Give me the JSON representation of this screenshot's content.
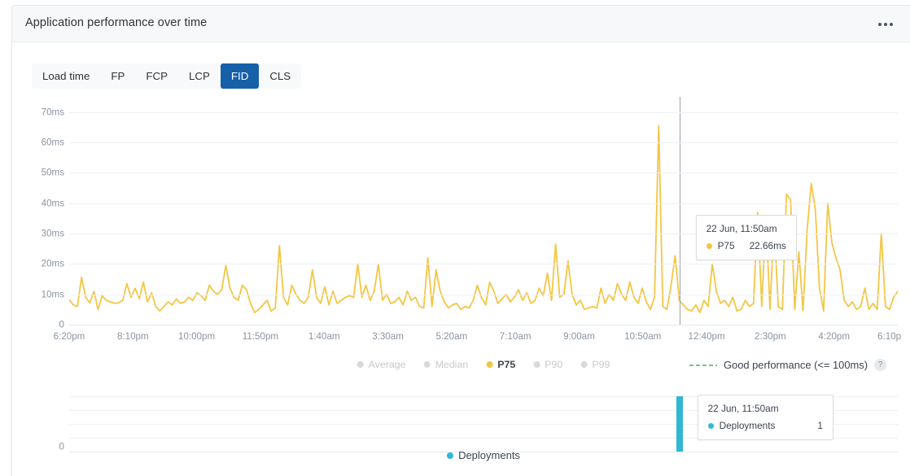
{
  "card": {
    "title": "Application performance over time",
    "menu_icon": "kebab-menu-icon"
  },
  "tabs": [
    {
      "label": "Load time",
      "active": false
    },
    {
      "label": "FP",
      "active": false
    },
    {
      "label": "FCP",
      "active": false
    },
    {
      "label": "LCP",
      "active": false
    },
    {
      "label": "FID",
      "active": true
    },
    {
      "label": "CLS",
      "active": false
    }
  ],
  "colors": {
    "accent_tab": "#1660a8",
    "p75_line": "#f3c644",
    "deployments": "#2fb8d6",
    "good_performance": "#7ec47e",
    "grid": "#eef0f2",
    "axis_text": "#8a94a0"
  },
  "legend": {
    "series": [
      {
        "label": "Average",
        "active": false,
        "color": "#d6d9dd"
      },
      {
        "label": "Median",
        "active": false,
        "color": "#d6d9dd"
      },
      {
        "label": "P75",
        "active": true,
        "color": "#f3c644"
      },
      {
        "label": "P90",
        "active": false,
        "color": "#d6d9dd"
      },
      {
        "label": "P99",
        "active": false,
        "color": "#d6d9dd"
      }
    ],
    "threshold_label": "Good performance (<= 100ms)",
    "help_icon": "?"
  },
  "tooltips": {
    "main": {
      "date": "22 Jun, 11:50am",
      "series_label": "P75",
      "value": "22.66ms",
      "dot_color": "#f3c644"
    },
    "deployments": {
      "date": "22 Jun, 11:50am",
      "series_label": "Deployments",
      "value": "1",
      "dot_color": "#2fb8d6"
    }
  },
  "deployments_legend": {
    "label": "Deployments",
    "color": "#2fb8d6"
  },
  "chart_data": {
    "type": "line",
    "title": "Application performance over time",
    "metric": "FID",
    "xlabel": "",
    "ylabel": "",
    "unit": "ms",
    "ylim": [
      0,
      75
    ],
    "yticks": [
      0,
      10,
      20,
      30,
      40,
      50,
      60,
      70
    ],
    "ytick_labels": [
      "0",
      "10ms",
      "20ms",
      "30ms",
      "40ms",
      "50ms",
      "60ms",
      "70ms"
    ],
    "xtick_labels": [
      "6:20pm",
      "8:10pm",
      "10:00pm",
      "11:50pm",
      "1:40am",
      "3:30am",
      "5:20am",
      "7:10am",
      "9:00am",
      "10:50am",
      "12:40pm",
      "2:30pm",
      "4:20pm",
      "6:10p"
    ],
    "grid": true,
    "legend_position": "bottom",
    "hover_index": 148,
    "series": [
      {
        "name": "P75",
        "color": "#f3c644",
        "visible": true,
        "values": [
          8.2,
          6.5,
          6.0,
          15.6,
          9.0,
          7.2,
          11.0,
          5.0,
          9.5,
          8.0,
          7.5,
          7.0,
          7.2,
          8.0,
          13.5,
          9.0,
          12.0,
          8.5,
          14.0,
          7.5,
          10.5,
          6.0,
          4.5,
          6.0,
          7.5,
          6.5,
          8.5,
          7.0,
          7.5,
          9.0,
          8.0,
          10.5,
          9.5,
          8.0,
          13.0,
          11.0,
          10.0,
          11.5,
          19.5,
          12.0,
          9.0,
          8.0,
          13.0,
          11.5,
          7.0,
          4.0,
          5.0,
          6.5,
          8.0,
          4.5,
          5.5,
          26.0,
          9.0,
          6.5,
          13.0,
          10.0,
          8.0,
          7.0,
          9.0,
          18.0,
          9.0,
          7.0,
          12.5,
          6.5,
          11.0,
          7.0,
          8.0,
          9.0,
          9.5,
          9.0,
          20.0,
          9.0,
          13.0,
          8.0,
          11.0,
          20.0,
          8.0,
          10.0,
          7.0,
          7.5,
          9.0,
          6.5,
          11.0,
          8.0,
          9.0,
          6.0,
          5.5,
          22.0,
          6.0,
          18.0,
          11.0,
          7.5,
          5.5,
          6.5,
          7.0,
          5.0,
          6.0,
          5.5,
          8.0,
          13.0,
          9.0,
          6.5,
          14.0,
          11.0,
          7.0,
          8.5,
          10.0,
          7.5,
          9.0,
          11.5,
          8.0,
          10.5,
          7.0,
          8.0,
          12.0,
          9.5,
          17.0,
          8.0,
          26.5,
          9.0,
          10.0,
          21.0,
          10.0,
          6.5,
          8.0,
          5.0,
          5.5,
          6.0,
          5.5,
          12.0,
          7.0,
          10.0,
          8.0,
          13.5,
          10.0,
          8.0,
          14.0,
          9.0,
          7.0,
          12.0,
          7.5,
          5.0,
          9.0,
          65.5,
          6.0,
          5.0,
          13.0,
          22.66,
          8.0,
          6.5,
          5.0,
          4.5,
          6.5,
          4.0,
          8.0,
          6.0,
          20.0,
          11.0,
          7.0,
          8.0,
          6.0,
          9.0,
          4.5,
          5.0,
          8.0,
          6.0,
          7.0,
          37.0,
          6.0,
          36.0,
          5.0,
          34.0,
          6.0,
          5.0,
          43.0,
          41.0,
          5.0,
          24.0,
          4.5,
          31.0,
          46.5,
          38.0,
          12.0,
          4.5,
          40.0,
          27.0,
          22.0,
          18.0,
          8.0,
          6.0,
          7.5,
          5.0,
          6.0,
          12.0,
          5.0,
          7.0,
          5.0,
          30.0,
          6.0,
          5.0,
          9.0,
          11.0
        ]
      }
    ],
    "threshold": {
      "label": "Good performance (<= 100ms)",
      "value": 100,
      "color": "#7ec47e",
      "style": "dashed"
    },
    "deployments_chart": {
      "type": "bar",
      "series_name": "Deployments",
      "color": "#2fb8d6",
      "ylim": [
        0,
        1
      ],
      "ytick_labels": [
        "0"
      ],
      "bars": [
        {
          "index": 148,
          "value": 1
        }
      ]
    }
  }
}
